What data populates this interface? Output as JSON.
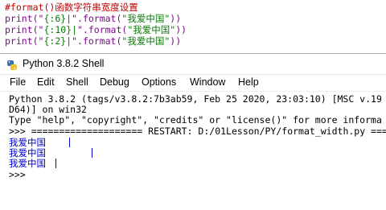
{
  "editor": {
    "lines": [
      {
        "comment": "#format()函数字符串宽度设置"
      },
      {
        "pre": "print(\"",
        "fmt": "{:6}|",
        "mid": "\".format(",
        "str": "\"我爱中国\"",
        "post": "))"
      },
      {
        "pre": "print(\"",
        "fmt": "{:10}|",
        "mid": "\".format(",
        "str": "\"我爱中国\"",
        "post": "))"
      },
      {
        "pre": "print(\"",
        "fmt": "{:2}|",
        "mid": "\".format(",
        "str": "\"我爱中国\"",
        "post": "))"
      }
    ]
  },
  "window": {
    "title": "Python 3.8.2 Shell",
    "menu": [
      "File",
      "Edit",
      "Shell",
      "Debug",
      "Options",
      "Window",
      "Help"
    ]
  },
  "shell": {
    "banner1": "Python 3.8.2 (tags/v3.8.2:7b3ab59, Feb 25 2020, 23:03:10) [MSC v.19",
    "banner2": "D64)] on win32",
    "banner3": "Type \"help\", \"copyright\", \"credits\" or \"license()\" for more informa",
    "prompt": ">>>",
    "restart": "==================== RESTART: D:/01Lesson/PY/format_width.py ======",
    "outputs": [
      "我爱中国",
      "我爱中国",
      "我爱中国"
    ]
  }
}
